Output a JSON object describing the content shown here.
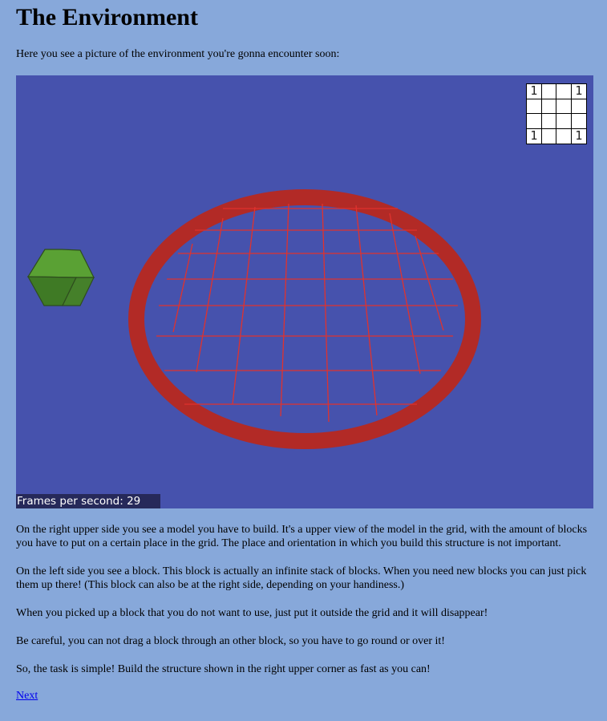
{
  "page": {
    "title": "The Environment",
    "intro": "Here you see a picture of the environment you're gonna encounter soon:"
  },
  "scene": {
    "background_color": "#4652ad",
    "ring_color": "#b22a26",
    "grid_line_color": "#e0322e",
    "cube_color": "#4c8c2c",
    "model_grid": {
      "rows": [
        [
          "1",
          "",
          "",
          "1"
        ],
        [
          "",
          "",
          "",
          ""
        ],
        [
          "",
          "",
          "",
          ""
        ],
        [
          "1",
          "",
          "",
          "1"
        ]
      ]
    },
    "fps_label": "Frames per second: 29"
  },
  "paragraphs": [
    "On the right upper side you see a model you have to build. It's a upper view of the model in the grid, with the amount of blocks you have to put on a certain place in the grid. The place and orientation in which you build this structure is not important.",
    "On the left side you see a block. This block is actually an infinite stack of blocks. When you need new blocks you can just pick them up there! (This block can also be at the right side, depending on your handiness.)",
    "When you picked up a block that you do not want to use, just put it outside the grid and it will disappear!",
    "Be careful, you can not drag a block through an other block, so you have to go round or over it!",
    "So, the task is simple! Build the structure shown in the right upper corner as fast as you can!"
  ],
  "next_link": "Next"
}
